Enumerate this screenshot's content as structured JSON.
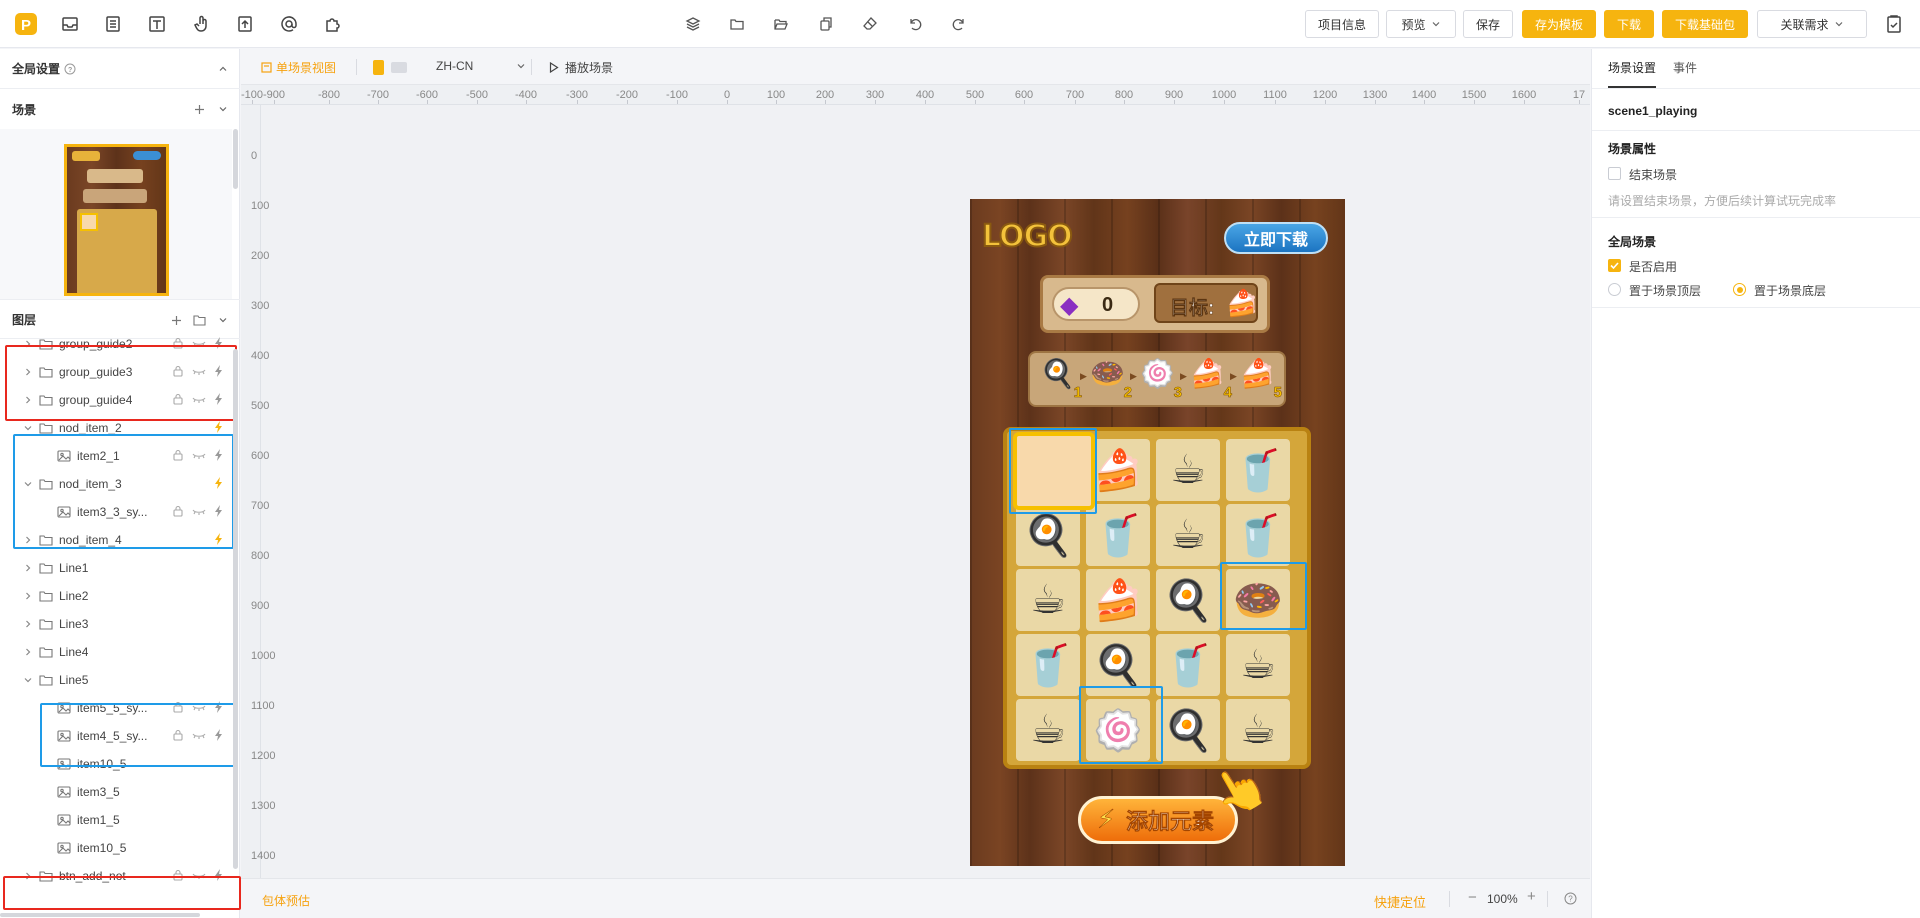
{
  "topbar": {
    "center_tools": [
      "layers-icon",
      "folder-icon",
      "folder-open-icon",
      "copy-icon",
      "eraser-icon",
      "undo-icon",
      "redo-icon"
    ],
    "project_info": "项目信息",
    "preview": "预览",
    "save": "保存",
    "save_template": "存为模板",
    "download": "下载",
    "download_base": "下载基础包",
    "related_demand": "关联需求"
  },
  "left": {
    "global_settings": "全局设置",
    "scene_title": "场景",
    "layers_title": "图层",
    "layers": [
      {
        "name": "group_guide2",
        "type": "folder",
        "expanded": false,
        "indent": 0
      },
      {
        "name": "group_guide3",
        "type": "folder",
        "expanded": false,
        "indent": 0
      },
      {
        "name": "group_guide4",
        "type": "folder",
        "expanded": false,
        "indent": 0
      },
      {
        "name": "nod_item_2",
        "type": "folder",
        "expanded": true,
        "indent": 0
      },
      {
        "name": "item2_1",
        "type": "image",
        "indent": 1
      },
      {
        "name": "nod_item_3",
        "type": "folder",
        "expanded": true,
        "indent": 0
      },
      {
        "name": "item3_3_sy...",
        "type": "image",
        "indent": 1
      },
      {
        "name": "nod_item_4",
        "type": "folder",
        "expanded": false,
        "indent": 0
      },
      {
        "name": "Line1",
        "type": "folder",
        "expanded": false,
        "indent": 0
      },
      {
        "name": "Line2",
        "type": "folder",
        "expanded": false,
        "indent": 0
      },
      {
        "name": "Line3",
        "type": "folder",
        "expanded": false,
        "indent": 0
      },
      {
        "name": "Line4",
        "type": "folder",
        "expanded": false,
        "indent": 0
      },
      {
        "name": "Line5",
        "type": "folder",
        "expanded": true,
        "indent": 0
      },
      {
        "name": "item5_5_sy...",
        "type": "image",
        "indent": 1
      },
      {
        "name": "item4_5_sy...",
        "type": "image",
        "indent": 1
      },
      {
        "name": "item10_5",
        "type": "image",
        "indent": 1
      },
      {
        "name": "item3_5",
        "type": "image",
        "indent": 1
      },
      {
        "name": "item1_5",
        "type": "image",
        "indent": 1
      },
      {
        "name": "item10_5",
        "type": "image",
        "indent": 1
      },
      {
        "name": "btn_add_not",
        "type": "folder",
        "expanded": false,
        "indent": 0
      }
    ]
  },
  "workspace": {
    "single_scene_view": "单场景视图",
    "language": "ZH-CN",
    "play_scene": "播放场景",
    "ruler_h": [
      "-100",
      "-900",
      "-800",
      "-700",
      "-600",
      "-500",
      "-400",
      "-300",
      "-200",
      "-100",
      "0",
      "100",
      "200",
      "300",
      "400",
      "500",
      "600",
      "700",
      "800",
      "900",
      "1000",
      "1100",
      "1200",
      "1300",
      "1400",
      "1500",
      "1600",
      "17"
    ],
    "ruler_v": [
      "0",
      "100",
      "200",
      "300",
      "400",
      "500",
      "600",
      "700",
      "800",
      "900",
      "1000",
      "1100",
      "1200",
      "1300",
      "1400"
    ],
    "package_estimate": "包体预估",
    "quick_locate": "快捷定位",
    "zoom": "100%"
  },
  "scene": {
    "logo": "LOGO",
    "download_now": "立即下载",
    "gem_count": "0",
    "target_label": "目标:",
    "sequence_numbers": [
      "1",
      "2",
      "3",
      "4",
      "5"
    ],
    "add_element": "添加元素"
  },
  "right": {
    "tab_scene_settings": "场景设置",
    "tab_events": "事件",
    "scene_name": "scene1_playing",
    "scene_props": "场景属性",
    "end_scene": "结束场景",
    "end_scene_hint": "请设置结束场景，方便后续计算试玩完成率",
    "global_scene": "全局场景",
    "enable": "是否启用",
    "top_layer": "置于场景顶层",
    "bottom_layer": "置于场景底层"
  },
  "colors": {
    "accent": "#f6b40f",
    "red_highlight": "#e8281e",
    "blue_highlight": "#1e9be8"
  }
}
